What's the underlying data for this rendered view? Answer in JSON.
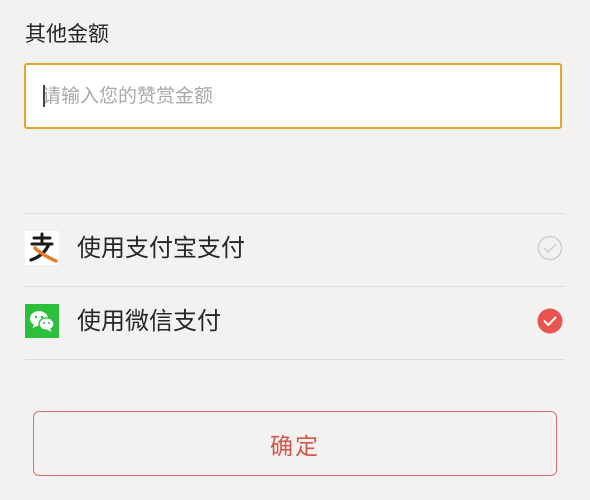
{
  "other_amount": {
    "label": "其他金额",
    "input_value": "",
    "input_placeholder": "请输入您的赞赏金额",
    "focus_color": "#e3a62f"
  },
  "payment_methods": [
    {
      "icon": "alipay-icon",
      "label": "使用支付宝支付",
      "selected": false,
      "brand_color": "#1a1a1a"
    },
    {
      "icon": "wechat-pay-icon",
      "label": "使用微信支付",
      "selected": true,
      "brand_color": "#2bbf3c"
    }
  ],
  "colors": {
    "selected_check": "#e85450",
    "unselected_check": "#cfcfcf",
    "confirm_text": "#d4564a"
  },
  "confirm": {
    "label": "确定"
  }
}
